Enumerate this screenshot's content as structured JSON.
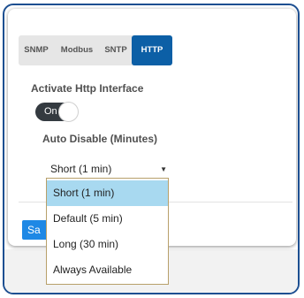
{
  "tabs": [
    {
      "label": "SNMP",
      "active": false
    },
    {
      "label": "Modbus",
      "active": false
    },
    {
      "label": "SNTP",
      "active": false
    },
    {
      "label": "HTTP",
      "active": true
    }
  ],
  "http": {
    "activate_label": "Activate Http Interface",
    "toggle_text": "On",
    "toggle_on": true,
    "auto_disable_label": "Auto Disable (Minutes)",
    "selected_value": "Short (1 min)",
    "options": [
      "Short (1 min)",
      "Default (5 min)",
      "Long (30 min)",
      "Always Available"
    ],
    "highlighted_option": "Short (1 min)"
  },
  "save_label": "Sa",
  "colors": {
    "frame_border": "#1d4f91",
    "tab_active_bg": "#0c5fa6",
    "toggle_bg": "#343a40",
    "save_bg": "#1e88e5",
    "option_highlight": "#a8d9f0"
  },
  "icons": {
    "select_arrow": "caret-down-icon"
  }
}
